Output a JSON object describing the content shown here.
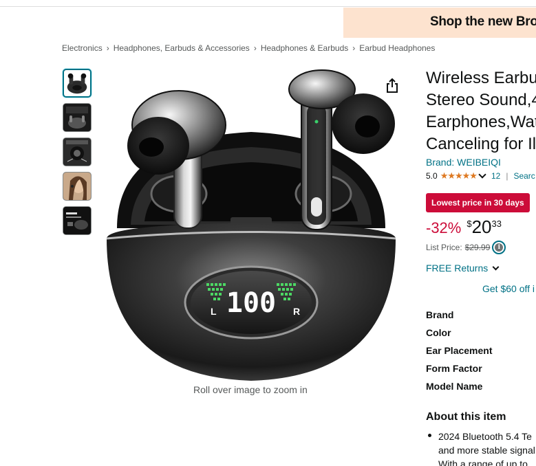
{
  "promo": {
    "text": "Shop the new Bro"
  },
  "breadcrumb": [
    "Electronics",
    "Headphones, Earbuds & Accessories",
    "Headphones & Earbuds",
    "Earbud Headphones"
  ],
  "gallery": {
    "thumbnails": [
      "earbuds-case-thumb",
      "earbuds-box-thumb",
      "earbud-detail-thumb",
      "woman-wearing-thumb",
      "specs-thumb"
    ],
    "zoom_hint": "Roll over image to zoom in",
    "display_text": "100",
    "left_mark": "L",
    "right_mark": "R"
  },
  "product": {
    "title_lines": [
      "Wireless Earbu",
      "Stereo Sound,4",
      "Earphones,Wat",
      "Canceling for Il"
    ],
    "brand": "Brand: WEIBEIQI",
    "rating": "5.0",
    "stars": "★★★★★",
    "rating_count": "12",
    "search_link": "Searc",
    "deal_badge": "Lowest price in 30 days",
    "discount": "-32%",
    "currency": "$",
    "price_whole": "20",
    "price_fraction": "33",
    "list_price_label": "List Price:",
    "list_price_value": "$29.99",
    "free_returns": "FREE Returns",
    "coupon": "Get $60 off i"
  },
  "specs": [
    "Brand",
    "Color",
    "Ear Placement",
    "Form Factor",
    "Model Name"
  ],
  "about": {
    "title": "About this item",
    "bullet_lines": [
      "2024 Bluetooth 5.4 Te",
      "and more stable signal",
      "With a range of up to"
    ]
  },
  "colors": {
    "link": "#007185",
    "deal": "#cc0c39",
    "star": "#de7921",
    "promo_bg": "#fde3cf"
  }
}
